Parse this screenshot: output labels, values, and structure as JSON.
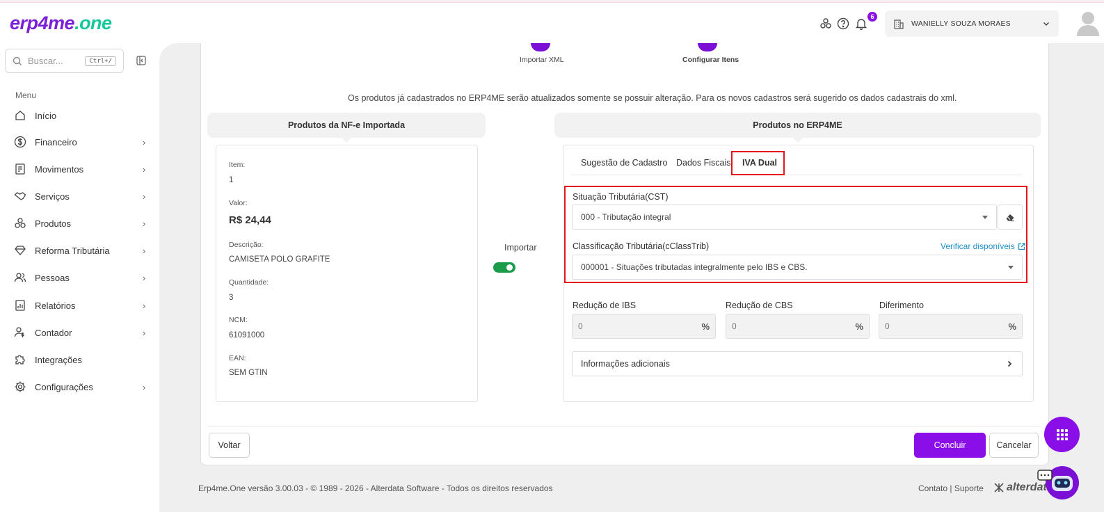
{
  "header": {
    "logo": {
      "part1": "erp4me",
      "part2": ".one"
    },
    "notification_count": "6",
    "user_name": "WANIELLY SOUZA MORAES"
  },
  "sidebar": {
    "search_placeholder": "Buscar...",
    "search_shortcut": "Ctrl+/",
    "menu_title": "Menu",
    "items": [
      {
        "label": "Início",
        "icon": "home-icon"
      },
      {
        "label": "Financeiro",
        "icon": "dollar-icon"
      },
      {
        "label": "Movimentos",
        "icon": "movements-icon"
      },
      {
        "label": "Serviços",
        "icon": "handshake-icon"
      },
      {
        "label": "Produtos",
        "icon": "boxes-icon"
      },
      {
        "label": "Reforma Tributária",
        "icon": "diamond-icon"
      },
      {
        "label": "Pessoas",
        "icon": "people-icon"
      },
      {
        "label": "Relatórios",
        "icon": "report-icon"
      },
      {
        "label": "Contador",
        "icon": "accountant-icon"
      },
      {
        "label": "Integrações",
        "icon": "puzzle-icon"
      },
      {
        "label": "Configurações",
        "icon": "gear-icon"
      }
    ]
  },
  "stepper": {
    "step1": "Importar XML",
    "step2": "Configurar Itens"
  },
  "info_text": "Os produtos já cadastrados no ERP4ME serão atualizados somente se possuir alteração. Para os novos cadastros será sugerido os dados cadastrais do xml.",
  "left_panel": {
    "title": "Produtos da NF-e Importada",
    "fields": [
      {
        "label": "Item:",
        "value": "1"
      },
      {
        "label": "Valor:",
        "value": "R$ 24,44"
      },
      {
        "label": "Descrição:",
        "value": "CAMISETA POLO GRAFITE"
      },
      {
        "label": "Quantidade:",
        "value": "3"
      },
      {
        "label": "NCM:",
        "value": "61091000"
      },
      {
        "label": "EAN:",
        "value": "SEM GTIN"
      }
    ]
  },
  "import_toggle": {
    "label": "Importar",
    "on": true
  },
  "right_panel": {
    "title": "Produtos no ERP4ME",
    "tabs": [
      "Sugestão de Cadastro",
      "Dados Fiscais",
      "IVA Dual"
    ],
    "active_tab": "IVA Dual",
    "cst": {
      "label": "Situação Tributária(CST)",
      "value": "000 - Tributação integral"
    },
    "cclass": {
      "label": "Classificação Tributária(cClassTrib)",
      "value": "000001 - Situações tributadas integralmente pelo IBS e CBS.",
      "link": "Verificar disponíveis"
    },
    "reducao_ibs": {
      "label": "Redução de IBS",
      "value": "0",
      "suffix": "%"
    },
    "reducao_cbs": {
      "label": "Redução de CBS",
      "value": "0",
      "suffix": "%"
    },
    "diferimento": {
      "label": "Diferimento",
      "value": "0",
      "suffix": "%"
    },
    "additional_info": "Informações adicionais"
  },
  "actions": {
    "back": "Voltar",
    "finish": "Concluir",
    "cancel": "Cancelar"
  },
  "footer": {
    "copyright": "Erp4me.One versão 3.00.03 - © 1989 - 2026 - Alterdata Software - Todos os direitos reservados",
    "links": "Contato | Suporte",
    "brand": "alterdata"
  },
  "colors": {
    "brand_purple": "#8a0ee8",
    "brand_green": "#16c79a",
    "highlight_red": "#e8141c",
    "toggle_green": "#1a9c4b",
    "link_blue": "#1e90c8"
  }
}
